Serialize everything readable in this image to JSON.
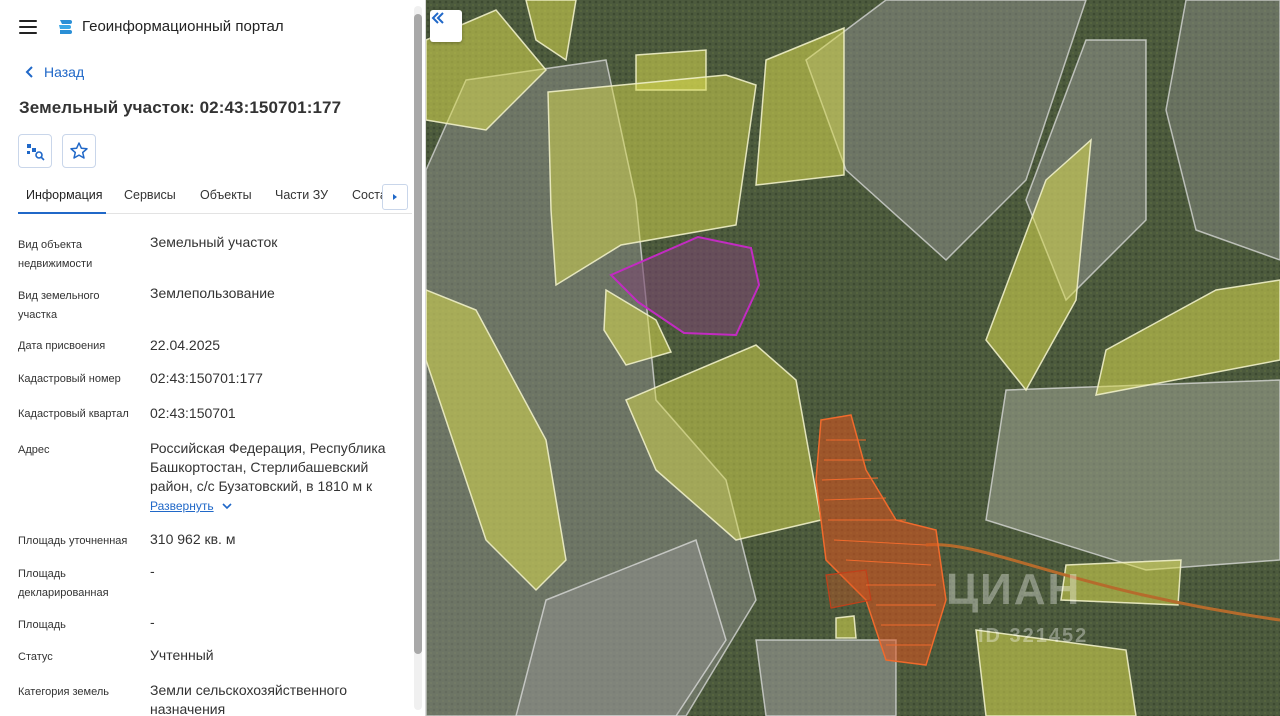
{
  "app": {
    "title": "Геоинформационный портал"
  },
  "nav": {
    "back_label": "Назад"
  },
  "parcel": {
    "title": "Земельный участок: 02:43:150701:177"
  },
  "tabs": [
    {
      "label": "Информация",
      "active": true
    },
    {
      "label": "Сервисы",
      "active": false
    },
    {
      "label": "Объекты",
      "active": false
    },
    {
      "label": "Части ЗУ",
      "active": false
    },
    {
      "label": "Соста",
      "active": false
    }
  ],
  "fields": [
    {
      "label": "Вид объекта недвижимости",
      "value": "Земельный участок"
    },
    {
      "label": "Вид земельного участка",
      "value": "Землепользование"
    },
    {
      "label": "Дата присвоения",
      "value": "22.04.2025"
    },
    {
      "label": "Кадастровый номер",
      "value": "02:43:150701:177"
    },
    {
      "label": "Кадастровый квартал",
      "value": "02:43:150701"
    },
    {
      "label": "Адрес",
      "value": "Российская Федерация, Республика Башкортостан, Стерлибашевский район, с/с Бузатовский, в 1810 м к"
    },
    {
      "label": "Площадь уточненная",
      "value": "310 962 кв. м"
    },
    {
      "label": "Площадь декларированная",
      "value": "-"
    },
    {
      "label": "Площадь",
      "value": "-"
    },
    {
      "label": "Статус",
      "value": "Учтенный"
    },
    {
      "label": "Категория земель",
      "value": "Земли сельскохозяйственного назначения"
    }
  ],
  "address_expand_label": "Развернуть",
  "map": {
    "watermark": "ЦИАН",
    "watermark_id": "ID 321452"
  },
  "colors": {
    "accent": "#2068c8",
    "selected_parcel": "#c22bc2",
    "highlight_fill": "#d7d94e",
    "settlement": "#e0531e"
  }
}
